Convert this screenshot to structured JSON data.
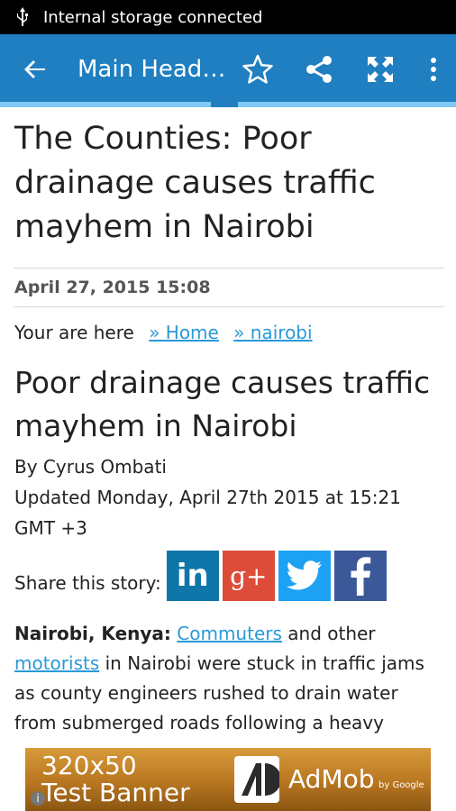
{
  "status": {
    "notification": "Internal storage connected"
  },
  "appbar": {
    "title": "Main Headlines",
    "progress_pct": 100
  },
  "article": {
    "headline": "The Counties: Poor drainage causes traffic mayhem in Nairobi",
    "date": "April 27, 2015 15:08",
    "breadcrumb": {
      "prefix": "Your are here",
      "home": "» Home",
      "section": "» nairobi"
    },
    "title": "Poor drainage causes traffic mayhem in Nairobi",
    "author": "By Cyrus Ombati",
    "updated": "Updated Monday, April 27th 2015 at 15:21 GMT +3",
    "share_label": "Share this story:",
    "body_lead": "Nairobi, Kenya:",
    "body_link1": "Commuters",
    "body_mid": " and other",
    "body_link2": "motorists",
    "body_rest": " in Nairobi were stuck in traffic jams as county engineers rushed to drain water from submerged roads following a heavy"
  },
  "share": {
    "linkedin": "in",
    "googleplus": "g+"
  },
  "ad": {
    "line1": "320x50",
    "line2": "Test Banner",
    "brand": "AdMob",
    "by": "by Google",
    "info": "i"
  },
  "colors": {
    "appbar": "#1f7fc0",
    "link": "#2a9ad8",
    "linkedin": "#0e76a8",
    "googleplus": "#dd4b39",
    "twitter": "#1da1f2",
    "facebook": "#3b5998"
  },
  "icons": [
    "usb-icon",
    "back-arrow-icon",
    "star-icon",
    "share-icon",
    "fullscreen-icon",
    "more-vert-icon"
  ]
}
